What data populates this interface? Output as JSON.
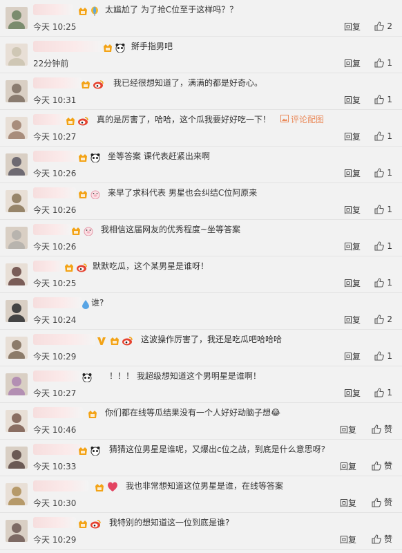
{
  "colors": {
    "background": "#f2f2f2",
    "text": "#333333",
    "accent": "#ea8a5a",
    "divider": "#e3e3e3"
  },
  "icons": {
    "like": "thumbs-up-icon",
    "badge": "vip-badge-icon",
    "image": "image-icon"
  },
  "img_link_label": "评论配图",
  "comments": [
    {
      "text": "太尴尬了 为了抢C位至于这样吗？？",
      "time": "今天 10:25",
      "reply": "回复",
      "likes": "2",
      "avatar": "#7b8c6e",
      "badges": [
        "vip",
        "balloon"
      ]
    },
    {
      "text": "掰手指男吧",
      "time": "22分钟前",
      "reply": "回复",
      "likes": "1",
      "avatar": "#cfc7b5",
      "badges": [
        "vip",
        "panda"
      ]
    },
    {
      "text": "我已经很想知道了，满满的都是好奇心。",
      "time": "今天 10:31",
      "reply": "回复",
      "likes": "1",
      "avatar": "#8a7c70",
      "badges": [
        "vip",
        "weibo"
      ]
    },
    {
      "text": "真的是厉害了，哈哈，这个瓜我要好好吃一下！",
      "time": "今天 10:27",
      "reply": "回复",
      "likes": "1",
      "avatar": "#a88d7c",
      "badges": [
        "vip",
        "weibo"
      ],
      "has_image": true
    },
    {
      "text": "坐等答案 课代表赶紧出来啊",
      "time": "今天 10:26",
      "reply": "回复",
      "likes": "1",
      "avatar": "#6e6a72",
      "badges": [
        "vip",
        "panda"
      ]
    },
    {
      "text": "来早了求科代表 男星也会纠结C位阿原来",
      "time": "今天 10:26",
      "reply": "回复",
      "likes": "1",
      "avatar": "#97856a",
      "badges": [
        "vip",
        "pig"
      ]
    },
    {
      "text": "我相信这届网友的优秀程度~坐等答案",
      "time": "今天 10:26",
      "reply": "回复",
      "likes": "1",
      "avatar": "#b8b4ae",
      "badges": [
        "vip",
        "pig"
      ]
    },
    {
      "text": "默默吃瓜，这个某男星是谁呀！",
      "time": "今天 10:25",
      "reply": "回复",
      "likes": "1",
      "avatar": "#7a5d58",
      "badges": [
        "vip",
        "weibo"
      ]
    },
    {
      "text": "谁?",
      "time": "今天 10:24",
      "reply": "回复",
      "likes": "2",
      "avatar": "#444444",
      "badges": [
        "drop"
      ]
    },
    {
      "text": "这波操作厉害了，我还是吃瓜吧哈哈哈",
      "time": "今天 10:29",
      "reply": "回复",
      "likes": "1",
      "avatar": "#8c7b6a",
      "badges": [
        "v",
        "vip",
        "weibo"
      ]
    },
    {
      "text": "！！！ 我超级想知道这个男明星是谁啊！",
      "time": "今天 10:27",
      "reply": "回复",
      "likes": "1",
      "avatar": "#b38fb3",
      "badges": [
        "panda"
      ]
    },
    {
      "text": "你们都在线等瓜结果没有一个人好好动脑子想😂",
      "time": "今天 10:46",
      "reply": "回复",
      "likes": "赞",
      "avatar": "#8a6e62",
      "badges": [
        "vip"
      ]
    },
    {
      "text": "猜猜这位男星是谁呢，又爆出c位之战，到底是什么意思呀?",
      "time": "今天 10:33",
      "reply": "回复",
      "likes": "赞",
      "avatar": "#6b5a55",
      "badges": [
        "vip",
        "panda"
      ]
    },
    {
      "text": "我也非常想知道这位男星是谁，在线等答案",
      "time": "今天 10:30",
      "reply": "回复",
      "likes": "赞",
      "avatar": "#b69a6a",
      "badges": [
        "vip",
        "heart"
      ]
    },
    {
      "text": "我特别的想知道这一位到底是谁?",
      "time": "今天 10:29",
      "reply": "回复",
      "likes": "赞",
      "avatar": "#7d6a64",
      "badges": [
        "vip",
        "weibo"
      ]
    }
  ]
}
